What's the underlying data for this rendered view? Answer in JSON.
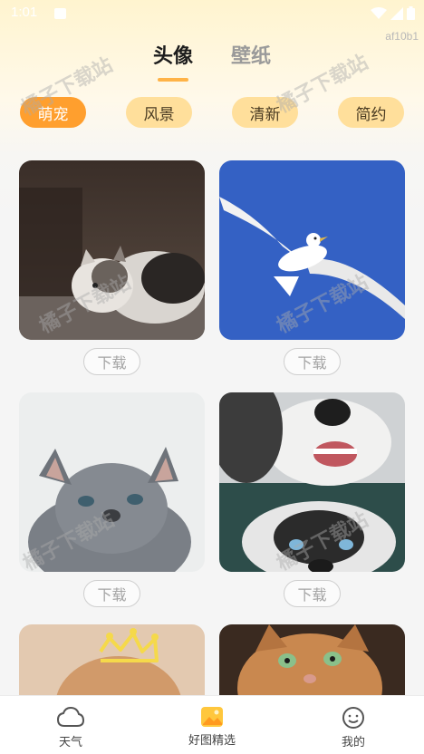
{
  "status_bar": {
    "time": "1:01",
    "device_code": "af10b1"
  },
  "top_tabs": [
    {
      "label": "头像",
      "active": true
    },
    {
      "label": "壁纸",
      "active": false
    }
  ],
  "chips": [
    {
      "label": "萌宠",
      "active": true
    },
    {
      "label": "风景",
      "active": false
    },
    {
      "label": "清新",
      "active": false
    },
    {
      "label": "简约",
      "active": false
    }
  ],
  "download_label": "下载",
  "watermark_text": "橘子下载站",
  "bottom_nav": [
    {
      "label": "天气",
      "icon": "cloud-icon",
      "active": false
    },
    {
      "label": "好图精选",
      "icon": "picture-icon",
      "active": true
    },
    {
      "label": "我的",
      "icon": "smiley-icon",
      "active": false
    }
  ],
  "colors": {
    "accent": "#ff9f2e",
    "chip_bg": "#ffdf9b",
    "tab_indicator": "#ffb347"
  }
}
